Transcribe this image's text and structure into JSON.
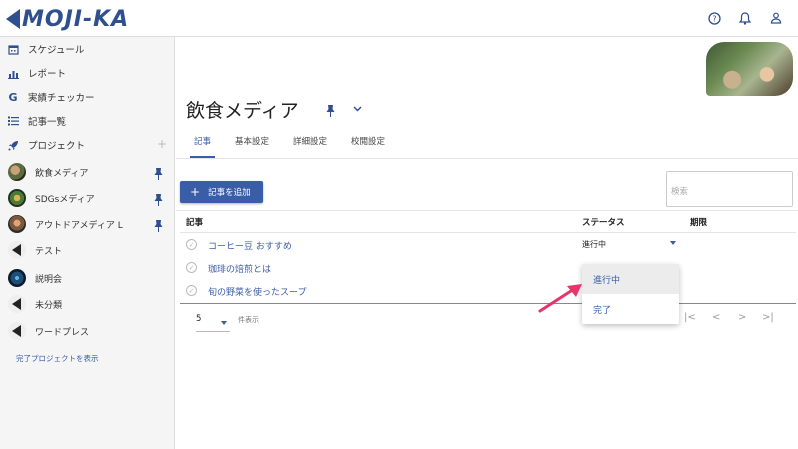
{
  "app": {
    "logo_text": "MOJI-KA"
  },
  "header": {
    "help_icon": "help-circle-icon",
    "bell_icon": "bell-icon",
    "user_icon": "user-icon"
  },
  "sidebar": {
    "nav": [
      {
        "label": "スケジュール",
        "icon": "calendar-icon"
      },
      {
        "label": "レポート",
        "icon": "bar-chart-icon"
      },
      {
        "label": "実績チェッカー",
        "icon": "google-g-icon"
      },
      {
        "label": "記事一覧",
        "icon": "list-icon"
      },
      {
        "label": "プロジェクト",
        "icon": "rocket-icon"
      }
    ],
    "add_project": "+",
    "projects": [
      {
        "label": "飲食メディア",
        "pinned": true
      },
      {
        "label": "SDGsメディア",
        "pinned": true
      },
      {
        "label": "アウトドアメディア L",
        "pinned": true
      },
      {
        "label": "テスト",
        "pinned": false
      },
      {
        "label": "説明会",
        "pinned": false
      },
      {
        "label": "未分類",
        "pinned": false
      },
      {
        "label": "ワードプレス",
        "pinned": false
      }
    ],
    "show_completed": "完了プロジェクトを表示"
  },
  "main": {
    "title": "飲食メディア",
    "tabs": [
      {
        "label": "記事",
        "active": true
      },
      {
        "label": "基本設定",
        "active": false
      },
      {
        "label": "詳細設定",
        "active": false
      },
      {
        "label": "校閲設定",
        "active": false
      }
    ],
    "add_button": "記事を追加",
    "search_placeholder": "検索",
    "columns": {
      "article": "記事",
      "status": "ステータス",
      "deadline": "期限"
    },
    "rows": [
      {
        "name": "コーヒー豆 おすすめ",
        "status": "進行中"
      },
      {
        "name": "珈琲の焙煎とは",
        "status": ""
      },
      {
        "name": "旬の野菜を使ったスープ",
        "status": ""
      }
    ],
    "per_page_value": "5",
    "per_page_label": "件表示",
    "pager": {
      "first": "|<",
      "prev": "<",
      "next": ">",
      "last": ">|"
    }
  },
  "dropdown": {
    "options": [
      "進行中",
      "完了"
    ],
    "highlighted": "進行中"
  },
  "colors": {
    "accent": "#3a5da8",
    "logo": "#2f4f8f",
    "pointer": "#e8336b"
  }
}
